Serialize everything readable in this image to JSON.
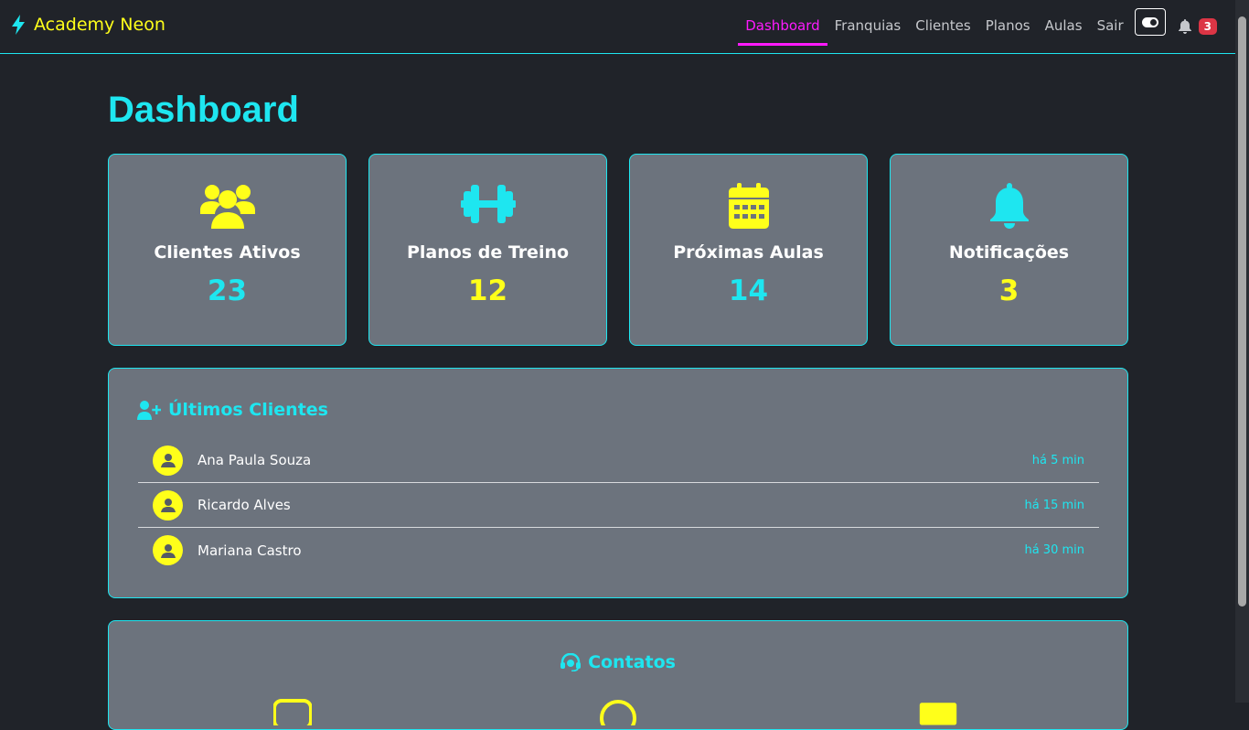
{
  "brand": {
    "name": "Academy Neon"
  },
  "nav": {
    "links": [
      {
        "label": "Dashboard",
        "active": true
      },
      {
        "label": "Franquias",
        "active": false
      },
      {
        "label": "Clientes",
        "active": false
      },
      {
        "label": "Planos",
        "active": false
      },
      {
        "label": "Aulas",
        "active": false
      },
      {
        "label": "Sair",
        "active": false
      }
    ],
    "notification_count": "3"
  },
  "page": {
    "title": "Dashboard"
  },
  "stats": [
    {
      "label": "Clientes Ativos",
      "value": "23",
      "icon": "users-icon"
    },
    {
      "label": "Planos de Treino",
      "value": "12",
      "icon": "dumbbell-icon"
    },
    {
      "label": "Próximas Aulas",
      "value": "14",
      "icon": "calendar-icon"
    },
    {
      "label": "Notificações",
      "value": "3",
      "icon": "bell-icon"
    }
  ],
  "recent_clients": {
    "title": "Últimos Clientes",
    "items": [
      {
        "name": "Ana Paula Souza",
        "time": "há 5 min"
      },
      {
        "name": "Ricardo Alves",
        "time": "há 15 min"
      },
      {
        "name": "Mariana Castro",
        "time": "há 30 min"
      }
    ]
  },
  "contacts": {
    "title": "Contatos"
  },
  "colors": {
    "accent_cyan": "#1ee6f0",
    "accent_yellow": "#ffff1a",
    "accent_magenta": "#ff1aff",
    "background": "#202329",
    "card": "#6c737d",
    "badge": "#dc3545"
  }
}
